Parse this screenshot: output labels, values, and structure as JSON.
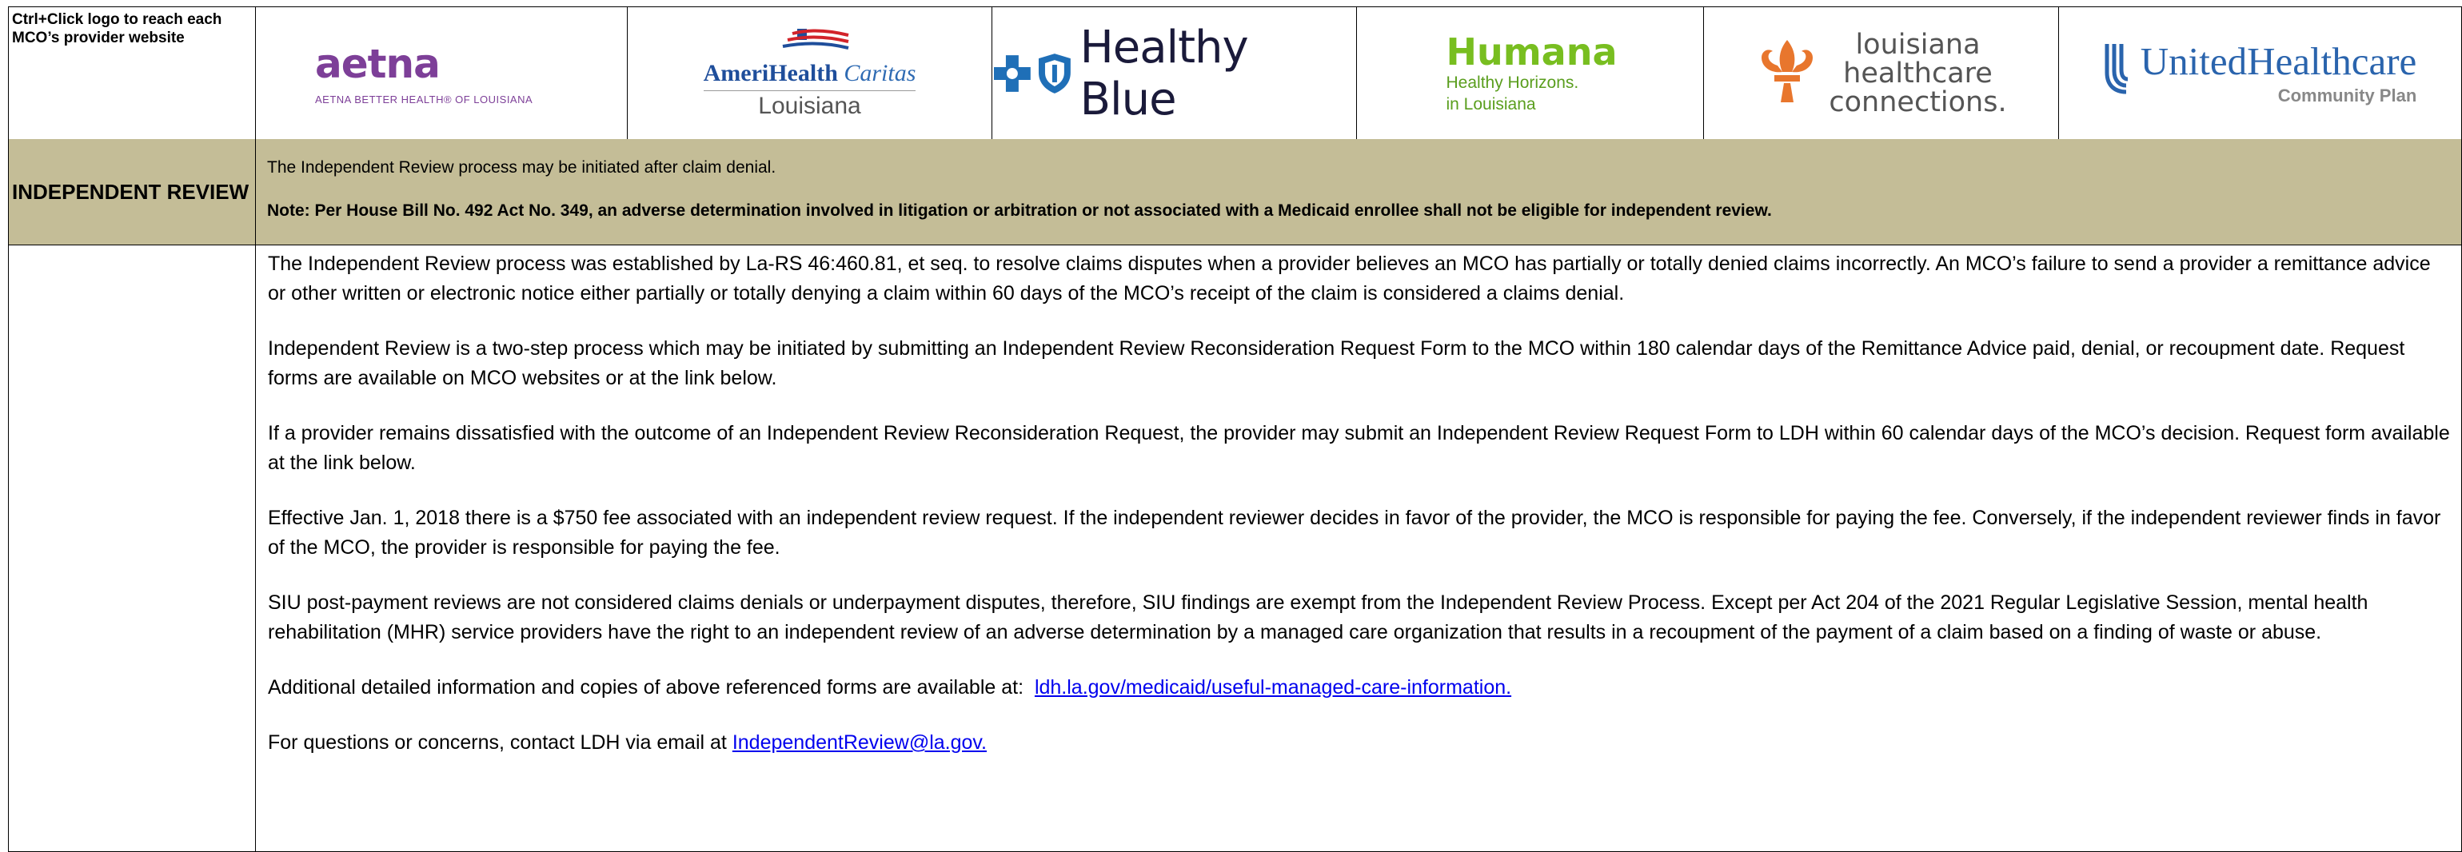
{
  "header": {
    "instruction": "Ctrl+Click logo to reach each MCO’s provider website",
    "logos": {
      "aetna": {
        "name": "aetna",
        "tagline": "AETNA BETTER HEALTH® OF LOUISIANA",
        "color": "#7d3f98"
      },
      "amerihealth": {
        "name_bold": "AmeriHealth",
        "name_italic": "Caritas",
        "region": "Louisiana",
        "color": "#1f4e9b"
      },
      "healthy_blue": {
        "name": "Healthy Blue",
        "color": "#1f6fb7"
      },
      "humana": {
        "name": "Humana",
        "line1": "Healthy Horizons.",
        "line2": "in Louisiana",
        "color": "#78be20"
      },
      "lhc": {
        "line1": "louisiana",
        "line2": "healthcare",
        "line3": "connections.",
        "color": "#e8762d"
      },
      "uhc": {
        "name": "UnitedHealthcare",
        "sub": "Community Plan",
        "color": "#2a64ad"
      }
    }
  },
  "banner": {
    "title": "INDEPENDENT REVIEW",
    "line1": "The Independent Review process may be initiated after claim denial.",
    "note": "Note: Per House Bill No. 492 Act No. 349, an adverse determination involved in litigation or arbitration or not associated with a Medicaid enrollee shall not be eligible for independent review.",
    "bg_color": "#c4bd97"
  },
  "body": {
    "p1": "The Independent Review process was established by La-RS 46:460.81, et seq. to resolve claims disputes when a provider believes an MCO has partially or totally denied claims incorrectly. An MCO’s failure to send a provider a remittance advice or other written or electronic notice either partially or totally denying a claim within 60 days of the MCO’s receipt of the claim is considered a claims denial.",
    "p2": "Independent Review is a two-step process which may be initiated by submitting an Independent Review Reconsideration Request Form to the MCO within 180 calendar days of the Remittance Advice paid, denial, or recoupment date. Request forms are available on MCO websites or at the link below.",
    "p3": "If a provider remains dissatisfied with the outcome of an Independent Review Reconsideration Request, the provider may submit an Independent Review Request Form to LDH within 60 calendar days of the MCO’s decision. Request form available at the link below.",
    "p4": "Effective Jan. 1, 2018 there is a $750 fee associated with an independent review request. If the independent reviewer decides in favor of the provider, the MCO is responsible for paying the fee. Conversely, if the independent reviewer finds in favor of the MCO, the provider is responsible for paying the fee.",
    "p5": "SIU post-payment reviews are not considered claims denials or underpayment disputes, therefore, SIU findings are exempt from the Independent Review Process. Except per Act 204 of the 2021 Regular Legislative Session, mental health rehabilitation (MHR) service providers have the right to an independent review of an adverse determination by a managed care organization that results in a recoupment of the payment of a claim based on a finding of waste or abuse.",
    "p6_prefix": "Additional detailed information and copies of above referenced forms are available at:",
    "p6_link": "ldh.la.gov/medicaid/useful-managed-care-information.",
    "p7_prefix": "For questions or concerns, contact LDH via email at",
    "p7_link": "IndependentReview@la.gov.",
    "link_color": "#0000ee"
  }
}
